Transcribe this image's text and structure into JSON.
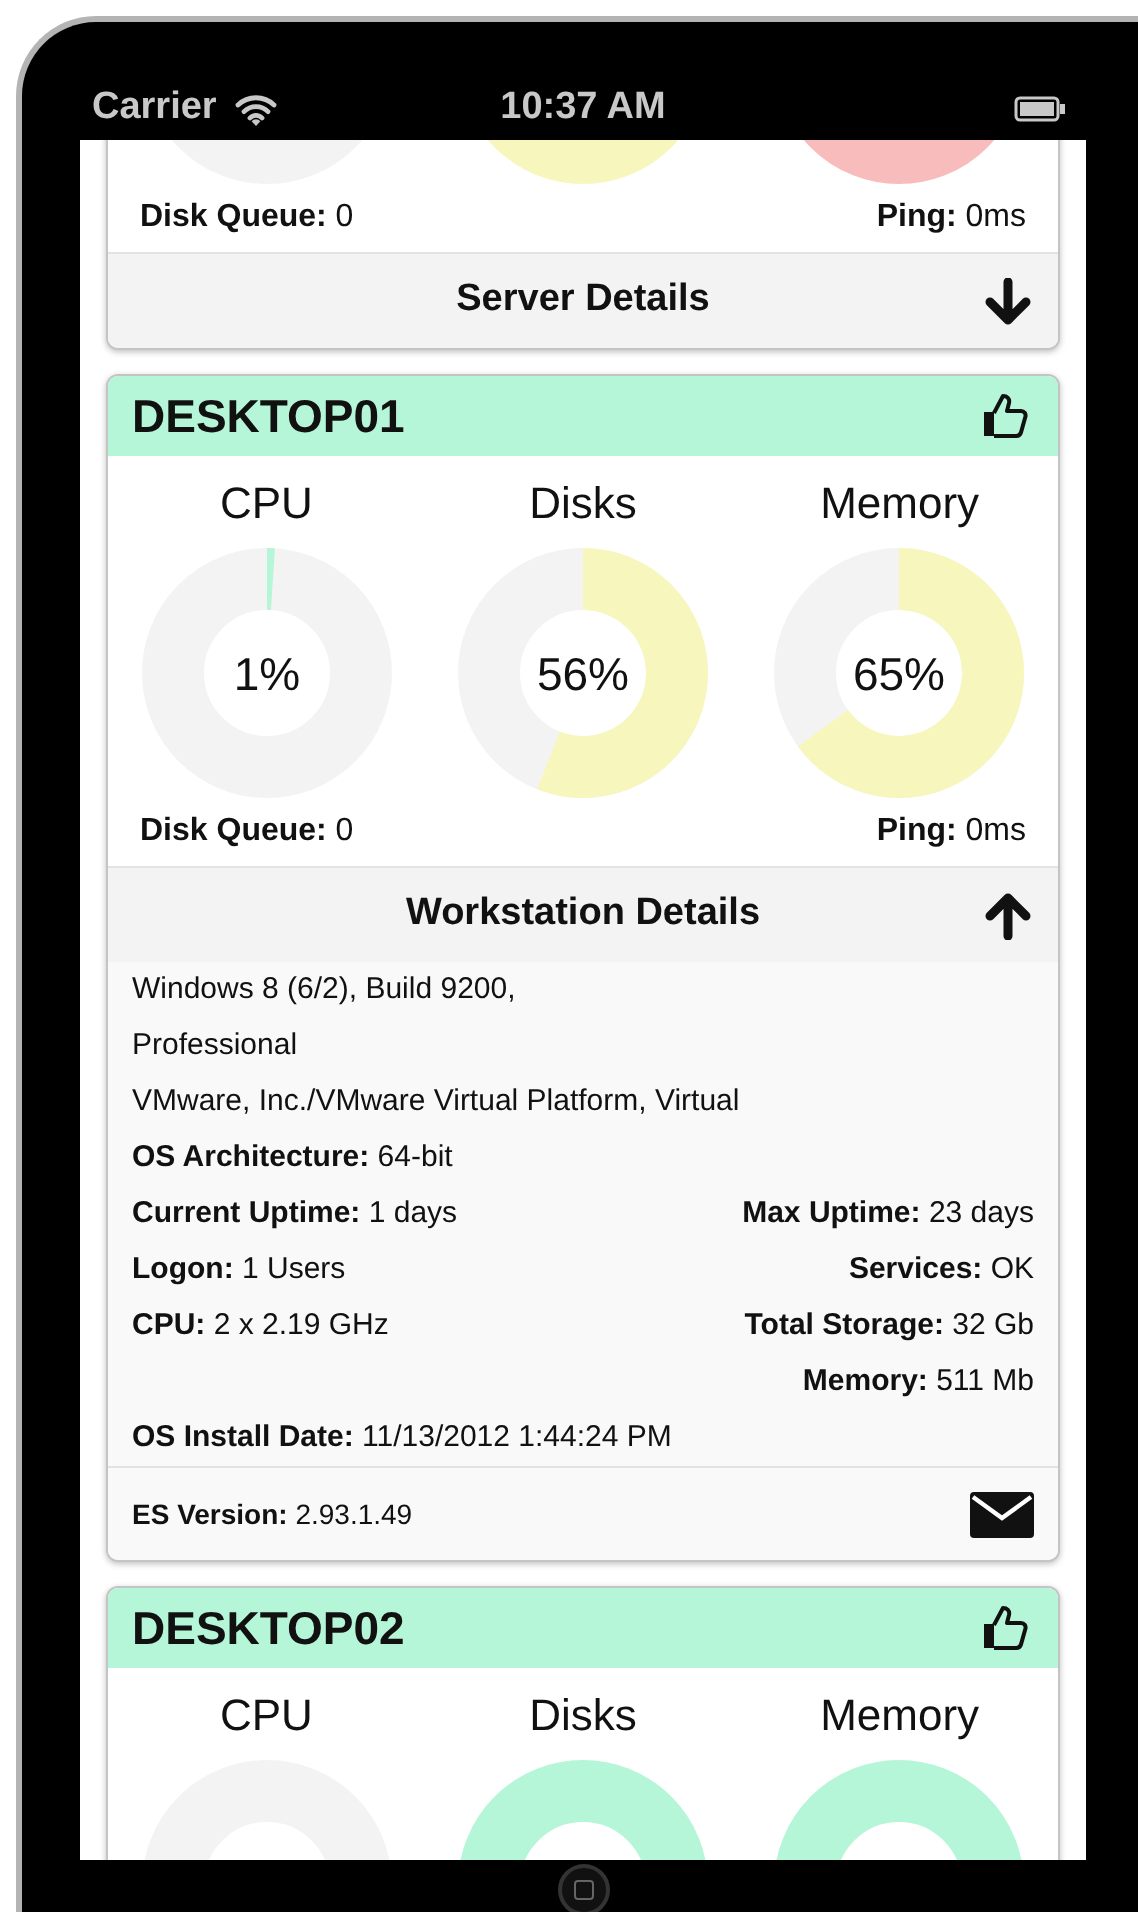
{
  "status_bar": {
    "carrier": "Carrier",
    "time": "10:37 AM"
  },
  "cards": [
    {
      "gauges": [
        {
          "color": "#f3f3f3"
        },
        {
          "color": "#f7f7bd"
        },
        {
          "color": "#f9bcbc"
        }
      ],
      "disk_queue": "**Disk Queue:** 0",
      "ping": "**Ping:** 0ms",
      "details_button": "Server Details",
      "expanded": false
    },
    {
      "title": "DESKTOP01",
      "ok": true,
      "gauges": [
        {
          "label": "CPU",
          "value": "1%",
          "color": "#b5f5d8"
        },
        {
          "label": "Disks",
          "value": "56%",
          "color": "#f7f7bd"
        },
        {
          "label": "Memory",
          "value": "65%",
          "color": "#f7f7bd"
        }
      ],
      "disk_queue": "**Disk Queue:** 0",
      "ping": "**Ping:** 0ms",
      "details_button": "Workstation Details",
      "expanded": true,
      "details": [
        {
          "left": "Windows 8 (6/2), Build 9200,"
        },
        {
          "left": "Professional"
        },
        {
          "left": "VMware, Inc./VMware Virtual Platform, Virtual"
        },
        {
          "left": "**OS Architecture:** 64-bit"
        },
        {
          "left": "**Current Uptime:** 1 days",
          "right": "**Max Uptime:** 23 days"
        },
        {
          "left": "**Logon:** 1 Users",
          "right": "**Services:** OK"
        },
        {
          "left": "**CPU:** 2 x 2.19 GHz",
          "right": "**Total Storage:** 32 Gb"
        },
        {
          "right": "**Memory:** 511 Mb"
        },
        {
          "left": "**OS Install Date:** 11/13/2012 1:44:24 PM"
        }
      ],
      "footer": "**ES Version:** 2.93.1.49"
    },
    {
      "title": "DESKTOP02",
      "ok": true,
      "gauges": [
        {
          "label": "CPU",
          "color": "#f3f3f3"
        },
        {
          "label": "Disks",
          "color": "#b5f5d8"
        },
        {
          "label": "Memory",
          "color": "#b5f5d8"
        }
      ]
    }
  ]
}
